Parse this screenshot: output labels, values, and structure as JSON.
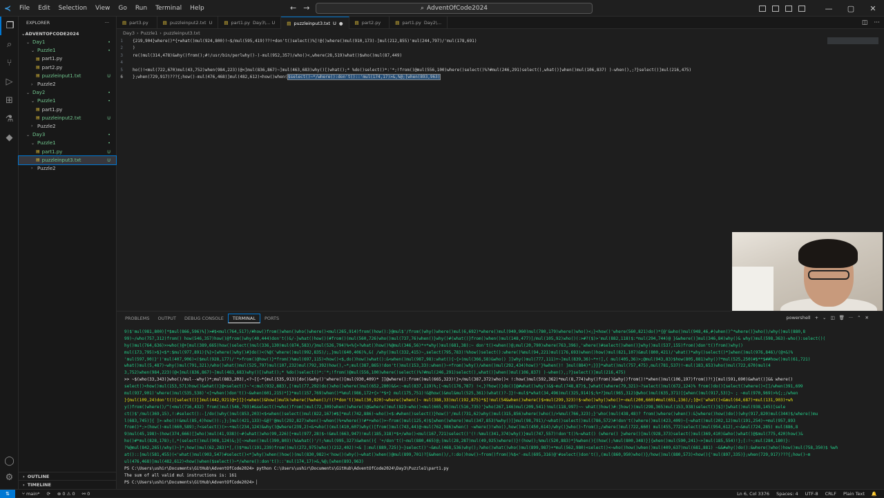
{
  "menu": [
    "File",
    "Edit",
    "Selection",
    "View",
    "Go",
    "Run",
    "Terminal",
    "Help"
  ],
  "command_center": "AdventOfCode2024",
  "explorer": {
    "header": "EXPLORER",
    "project": "ADVENTOFCODE2024",
    "items": [
      {
        "label": "Day1",
        "level": 1,
        "type": "folder",
        "badge": "•",
        "mod": true
      },
      {
        "label": "Puzzle1",
        "level": 2,
        "type": "folder",
        "badge": "•",
        "mod": true
      },
      {
        "label": "part1.py",
        "level": 3,
        "type": "file",
        "badge": "",
        "mod": false
      },
      {
        "label": "part2.py",
        "level": 3,
        "type": "file",
        "badge": "",
        "mod": false
      },
      {
        "label": "puzzleinput1.txt",
        "level": 3,
        "type": "file",
        "badge": "U",
        "mod": true
      },
      {
        "label": "Puzzle2",
        "level": 2,
        "type": "closed",
        "badge": "",
        "mod": false
      },
      {
        "label": "Day2",
        "level": 1,
        "type": "folder",
        "badge": "•",
        "mod": true
      },
      {
        "label": "Puzzle1",
        "level": 2,
        "type": "folder",
        "badge": "•",
        "mod": true
      },
      {
        "label": "part1.py",
        "level": 3,
        "type": "file",
        "badge": "",
        "mod": false
      },
      {
        "label": "puzzleinput2.txt",
        "level": 3,
        "type": "file",
        "badge": "U",
        "mod": true
      },
      {
        "label": "Puzzle2",
        "level": 2,
        "type": "closed",
        "badge": "",
        "mod": false
      },
      {
        "label": "Day3",
        "level": 1,
        "type": "folder",
        "badge": "•",
        "mod": true
      },
      {
        "label": "Puzzle1",
        "level": 2,
        "type": "folder",
        "badge": "•",
        "mod": true
      },
      {
        "label": "part1.py",
        "level": 3,
        "type": "file",
        "badge": "U",
        "mod": true
      },
      {
        "label": "puzzleinput3.txt",
        "level": 3,
        "type": "file",
        "badge": "U",
        "mod": true,
        "selected": true
      },
      {
        "label": "Puzzle2",
        "level": 2,
        "type": "closed",
        "badge": "",
        "mod": false
      }
    ],
    "outline": "OUTLINE",
    "timeline": "TIMELINE"
  },
  "tabs": [
    {
      "label": "part3.py",
      "desc": "",
      "active": false
    },
    {
      "label": "puzzleinput2.txt",
      "desc": "U",
      "active": false
    },
    {
      "label": "part1.py",
      "desc": "Day3\\...  U",
      "active": false
    },
    {
      "label": "puzzleinput3.txt",
      "desc": "U",
      "active": true,
      "dirty": true
    },
    {
      "label": "part2.py",
      "desc": "",
      "active": false
    },
    {
      "label": "part1.py",
      "desc": "Day2\\...",
      "active": false
    }
  ],
  "breadcrumb": [
    "Day3",
    "Puzzle1",
    "puzzleinput3.txt"
  ],
  "editor_lines": [
    {
      "no": "1",
      "text": "{219,904}where()*{+what()mul(924,800)!~$/mul(595,419)??!+don't()select()%]!@()where()mul(910,173)-]mul(212,855)'mul(244,797)/'mul(178,691)",
      "sel": ""
    },
    {
      "no": "2",
      "text": ")",
      "sel": ""
    },
    {
      "no": "3",
      "text": "re()mul(314,478)&why()from();#!/usr/bin/perlwhy()-)-mul(952,357)/who()<,where(28,519)what()$who()mul(87,449)",
      "sel": ""
    },
    {
      "no": "4",
      "text": "",
      "sel": ""
    },
    {
      "no": "5",
      "text": "ho()!<mul(722,670)mul(43,752)when(984,223)(@<]mul(836,867)~]mul(463,683)why()[)what();* %do()select()*:'*;!from()@mul(556,100)where()select()%?#mul(246,291)select(),what()]when()mul(106,837) )-when(),;?}select()]mul(216,475)",
      "sel": ""
    },
    {
      "no": "6",
      "text": "};when(729,917)???{;how()-mul(476,468)]mul(482,612)<how()when(",
      "sel": "$select()~*/where():don't()::'mul(174,17)>&,%@;[when(893,963)"
    }
  ],
  "panel_tabs": [
    "PROBLEMS",
    "OUTPUT",
    "DEBUG CONSOLE",
    "TERMINAL",
    "PORTS"
  ],
  "terminal_shell": "powershell",
  "terminal_lines": [
    {
      "c": "g",
      "t": "9)$'mul(981,800)[*$mul(866,596)%])>#$<mul(764,517)/#how()from()when()who()where()<mul(265,914)from()how():}@mul$'/from()why()where()mul(6,692)*where()mul(940,960)mul(780,179)where()who()<;}<how()'where(560,821)do()*{@'&who()mul(948,46,#(when()^*where()}who()/why()mul(880,8"
    },
    {
      "c": "g",
      "t": "99)~/who(757,312)from() how(546,357)how()@from()why(40,444)don't()&/-}what()how()(#from()(mul(560,726)who()mul(737,76)when()}why()#(what()}from()when()mul(148,477)]/mul(105,92)who()(:>#?($)>'mul(882,118)$:*mul(294,744)@ }&where()]mul(346,84)why()& why()mul(598,363)-who():select()("
    },
    {
      "c": "g",
      "t": "hy()mul(764,636)>>who()@+[mul(389,665)how()select()mul(336,130)mul(874,583)/}mul(526,794)%<%{>?what()how()%@mul(346,56)*+*why()mul(681,38):~ don't()<when()@;mul(20,790)where(763,396),'where()#select()when()}why()mul(537,155)from()don't()from()why()"
    },
    {
      "c": "g",
      "t": "mul(173,795)>$}<$*:$mul(977,891){%}>[where()why()#}do()<(%@('where()mul(992,835)/;,}mul(640,406)%,&( /why()mul(332,415)~,select(795,783)!%how()select():where()%mul(94,221)mul(176,693)when()how()mul(821,107)&mul(800,421)/'what()*why()select()*]when()mul(976,846)/(@+&)%"
    },
    {
      "c": "g",
      "t": "'mul(597,90)}')'mul(407,906)<($mul(928,177)/'*>from()@how()}*from()%mul(697,115)<how()<$,do()how()what():&<when()mul(987,98):what(){~{>(mul(366,58)&who() ]]why()mul(777,111)+~]mul(839,36)~*+!],( mul(405,36)>;@mul(943,83)$how(805,881)why()?*mul(525,250)#$**$##how()mul(61,721)"
    },
    {
      "c": "g",
      "t": "what()mul(5,487)~why()mul(791,321)/who()what()mul(525,797)mul(107,232)mul(792,392)how(),~*;mul(387,865)!don't()mul(153,33):when()~+from()why()/when()mul(292,434)how()'}%when()! ]mul(884)*;}}}*what()mul(757,475),mul(781,537)!~mul(183,653)who()mul(722,670)mul(4"
    },
    {
      "c": "g",
      "t": "3,752)when(984,223)(@<]mul(836,867)~]mul(463,683)why()[)what();* %do()select()*:'*;!from()@mul(556,100)where()select()%?#mul(246,291)select(),what()]when()mul(106,837) )-when(),;?}select()]mul(216,475)"
    },
    {
      "c": "w",
      "t": ">> ~$(who(33,343)}who()/mul--why()*;mul(883,203),<?~[{~*{mul(535,913)[do()&why()'where()[mul(930,409)* ]]@where():from()mul(665,323)!}>/mul(387,372)who()< !:how()mul(592,362)*mul(8,774)why()from()&why()from()!*when()mul(106,197)from()?!}[mul(591,690)&what()]&& where()"
    },
    {
      "c": "g",
      "t": "select()<how()mul(153,571)how()&what()}@<select()~'<:mul(932,883),[!mul(77,292)do()who()where()mul(652,280)&&<:~mul(837,119)%;[~mul(176,787) !<,}?how()}do()[@#what()why()&$~mul(748,87)$,]what()where(79,321)~?select()mul(672,124)% from()do()[select()where()<[]/when(391,699"
    },
    {
      "c": "g",
      "t": "mul(937,901)'where()mul(535,538)'<]+when()don't()~&when(601,215)*]}*mul(157,769)when()*%mul(986,172+{>'*$+} mul(175,751)!&@how()&mul&mul(525,361)(what()?-]}!~mul$*what(34,496)mul(325,914)$;%+?}mul(965,312)@who()mul(635,371)[{when()mul(917,53)}~ ; ~mul(970,969)>%{;;/when"
    },
    {
      "c": "y",
      "t": "}{mul(109,24)don't()[select()]]mul(442,921)@+}]}(<when()&how()mulk!where()%when()/!(?*don't()mul(30,920)~where()when()~ mul(388,33)mul(192,875)*$]!mul(54&when()where()$>mul(299,323)!$~who()why()who()+~mul(200,660)#mul(651,136)/;[@<('what()<&mul(64,687)+mul(131,903)+wh"
    },
    {
      "c": "g",
      "t": "y()from()where()/^(<mul(716,432) from()mul(546,793)#&select()+who()from()mul(72,309)when()where()@&where()mul(823~who()<mul(665,95)mul(516,735)'}who(267,146)mul(209,541)!mul(118,997)~~ what()how()#:]how()(mul(298,365)mul(153,938)select()]$]!]what()mul(938,145)[sele"
    },
    {
      "c": "g",
      "t": "ct()$'/mul(369,15),!:#select():-[/do()why()mul(853,203)<$<when()select()mul(822,167)#$]*mul(742,886)~who()<$:#when()select()}how()'/mul(731,62)why()mul(315,856)where()who()/>%mul(766,323);}'who()mul(438,48)? from()where()when():&}where()how()do()(why(917,820)mul(344)$/where()mu"
    },
    {
      "c": "g",
      "t": "l(683,745)]{ ]>-who()!&mul(85,4)how()):;};]mul(421,133)~&@?'@mul(292,827)when()~when()%+where()!#*+who()>~from()mul(125,4)$[when()where()mul(347,853)%why()]}mul(98,791)/~what()select()mul(786,572)#!don't()where()mul(423,409)~[~what()mul(202,12)mul(191,254)~+mul(957,893"
    },
    {
      "c": "g",
      "t": "from()*;>(how()~mul(660,589);?<select()(>~+mul(234,124)&why()@where(239,2)<&+who()(mul(410,607)why()[from()mul(743,44)@~mul(762,986)when() ~where()!who(),how()mul(450,614)/why()}who()~from();/where()mul(722,660) mul(455,772)select()mul(954,612),<~&mul(724,285) mul(886,8"
    },
    {
      "c": "g",
      "t": "9)mul(45,198)~)how(374,666)[]who()mul(41,938)(~#(what()who(99,226)[+mul(977,28)$~!&mul(663,947)!mul(185,318)*$+/who()<mul(167,721)select()'(!:%mul(341,374)why()}mul(747,557)!don't()%~what() (where() }where()[mul(928,373)select()mul(369,410)&who()what()@$mul(775,420)how()&"
    },
    {
      "c": "g",
      "t": "ho()#*mul(828,178);(,*(select()mul(908,124)&;}[~>when()mul(390,803)(%&what()'/!;%mul(995,327)&when(){ '+/don't()~mul(880,465)@;(mul(28,287)mul(49,925)where()}!(how();%mul(520,883)*}%when(){(how();%mul(800,348)}]{when()mul(590,241)~>]mul(185,554)!};[:!~;mul(284,180)}:"
    },
    {
      "c": "g",
      "t": "?%@mul(842,265)/why()~}*;how()mul(62,283)*[,()$*mul(191,239)from()mul(272,975)who()(212,402)!<& ]:mul(889,725)}~}select()'~&mul(468,536)why();?who()what()who()mul(899,987)+*mul(562,980)<select()<~who()how()when()mul(409,637)mul(681,881) ~&&#why()do():&where()who()how()mul(758,350)$ %wh"
    },
    {
      "c": "g",
      "t": "at()::[mul(581,455)(<'what()mul(903,547)#select()<*]why()when()how()(mul(830,982)<'how()(why()~what()when()@mul(899,701)?[&when()/,!:do()how()~from()from()%$<'-mul(695,316)@'#select()don't(),(mul(860,950)who()}/how()mul(880,573)<how(){'mul(897,335)};when(729,917)???{;how()~m"
    },
    {
      "c": "g",
      "t": "ul(476,468)]mul(482,612)<how()when($select()~*/where():don't()::'mul(174,17)>&,%@;[when(893,963)"
    },
    {
      "c": "w",
      "t": "PS C:\\Users\\ushir\\Documents\\GitHub\\AdventOfCode2024> python C:\\Users\\ushir\\Documents\\GitHub\\AdventOfCode2024\\Day3\\Puzzle1\\part1.py"
    },
    {
      "c": "w",
      "t": "The sum of all valid mul instructions is: 161"
    },
    {
      "c": "w",
      "t": "PS C:\\Users\\ushir\\Documents\\GitHub\\AdventOfCode2024> "
    }
  ],
  "status": {
    "branch": "main*",
    "sync": "⟳",
    "problems": "⊗ 0 ⚠ 0",
    "ports": "⚯ 0",
    "position": "Ln 6, Col 3376",
    "spaces": "Spaces: 4",
    "encoding": "UTF-8",
    "eol": "CRLF",
    "language": "Plain Text"
  }
}
